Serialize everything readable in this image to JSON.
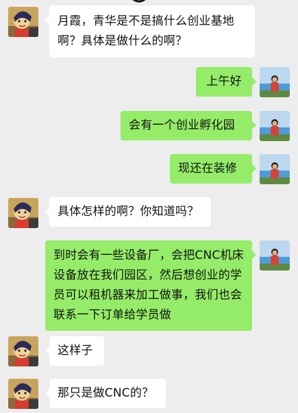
{
  "contacts": {
    "other_avatar_icon": "cartoon-girl-avatar-icon",
    "self_avatar_icon": "seaside-woman-photo-avatar-icon"
  },
  "messages": [
    {
      "sender": "other",
      "text": "月霞，青华是不是搞什么创业基地啊？具体是做什么的啊？"
    },
    {
      "sender": "self",
      "text": "上午好"
    },
    {
      "sender": "self",
      "text": "会有一个创业孵化园"
    },
    {
      "sender": "self",
      "text": "现还在装修"
    },
    {
      "sender": "other",
      "text": "具体怎样的啊？你知道吗？"
    },
    {
      "sender": "self",
      "text": "到时会有一些设备厂，会把CNC机床设备放在我们园区，然后想创业的学员可以租机器来加工做事，我们也会联系一下订单给学员做"
    },
    {
      "sender": "other",
      "text": "这样子"
    },
    {
      "sender": "other",
      "text": "那只是做CNC的？"
    }
  ],
  "colors": {
    "background": "#ededed",
    "incoming_bubble": "#ffffff",
    "outgoing_bubble": "#95ec69",
    "text": "#111111"
  }
}
